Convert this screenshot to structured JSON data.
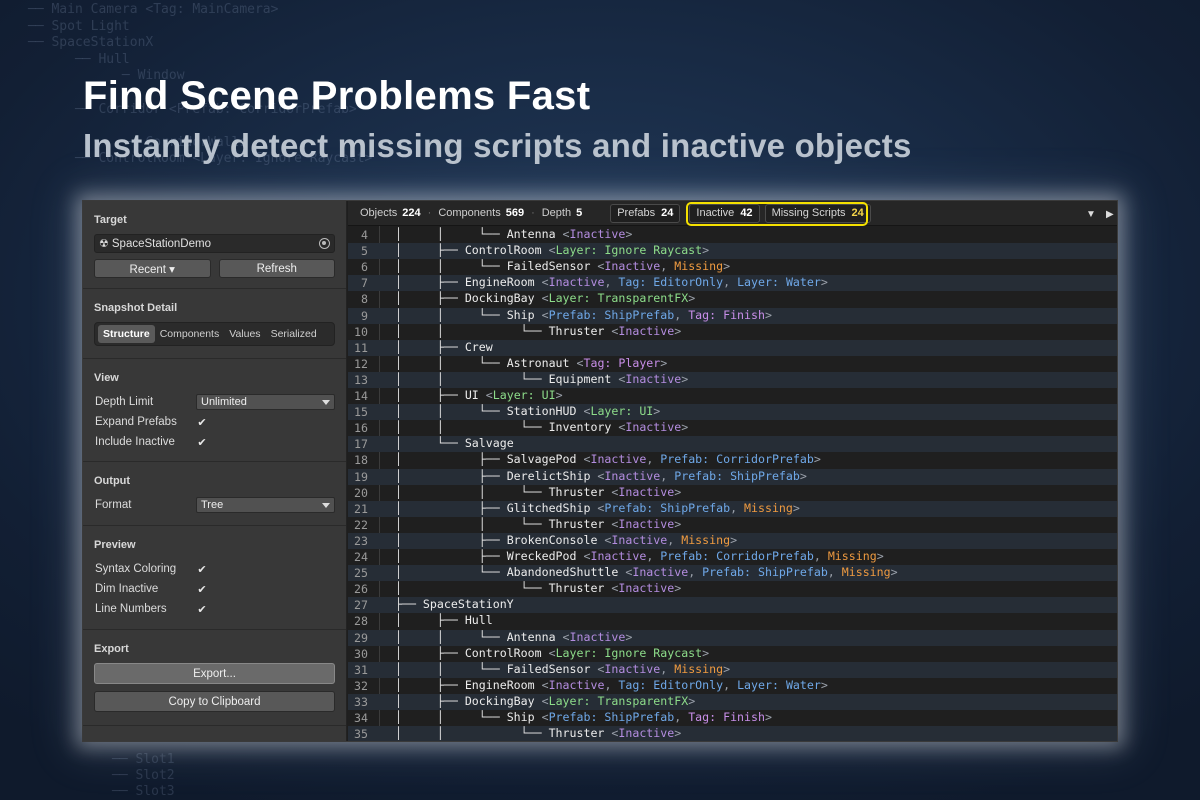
{
  "headline": "Find Scene Problems Fast",
  "subheadline": "Instantly detect missing scripts and inactive objects",
  "background_tree": [
    "── Main Camera <Tag: MainCamera>",
    "── Spot Light",
    "── SpaceStationX",
    "      ── Hull",
    "            ─ Window",
    "",
    "      ── Corridor <Prefab: CorridorPrefab>",
    "",
    "            ── CorridorWalls",
    "      ── ControlRoom <Layer: Ignore Raycast>"
  ],
  "background_tree_bottom": [
    "── Slot1",
    "── Slot2",
    "── Slot3"
  ],
  "sidebar": {
    "target": {
      "title": "Target",
      "value": "SpaceStationDemo",
      "icon": "radiation-icon",
      "recent_label": "Recent ▾",
      "refresh_label": "Refresh"
    },
    "snapshot": {
      "title": "Snapshot Detail",
      "tabs": [
        "Structure",
        "Components",
        "Values",
        "Serialized"
      ],
      "active_tab": "Structure"
    },
    "view": {
      "title": "View",
      "depth_limit_label": "Depth Limit",
      "depth_limit_value": "Unlimited",
      "expand_prefabs_label": "Expand Prefabs",
      "expand_prefabs": true,
      "include_inactive_label": "Include Inactive",
      "include_inactive": true
    },
    "output": {
      "title": "Output",
      "format_label": "Format",
      "format_value": "Tree"
    },
    "preview": {
      "title": "Preview",
      "syntax_coloring_label": "Syntax Coloring",
      "syntax_coloring": true,
      "dim_inactive_label": "Dim Inactive",
      "dim_inactive": true,
      "line_numbers_label": "Line Numbers",
      "line_numbers": true
    },
    "export": {
      "title": "Export",
      "export_label": "Export...",
      "copy_label": "Copy to Clipboard"
    }
  },
  "stats": {
    "objects_label": "Objects",
    "objects": "224",
    "components_label": "Components",
    "components": "569",
    "depth_label": "Depth",
    "depth": "5",
    "prefabs_label": "Prefabs",
    "prefabs": "24",
    "inactive_label": "Inactive",
    "inactive": "42",
    "missing_label": "Missing Scripts",
    "missing": "24"
  },
  "colors": {
    "highlight": "#f4e000",
    "inactive": "#b48de0",
    "layer": "#8ddc8a",
    "tag": "#c88ee8",
    "prefab": "#6fa8e8",
    "missing": "#ee9a40"
  },
  "lines": [
    {
      "n": "4",
      "prefix": "│     │     └── ",
      "name": "Antenna",
      "attrs": [
        {
          "t": "Inactive",
          "k": "inactive"
        }
      ]
    },
    {
      "n": "5",
      "prefix": "│     ├── ",
      "name": "ControlRoom",
      "attrs": [
        {
          "t": "Layer: Ignore Raycast",
          "k": "layer"
        }
      ]
    },
    {
      "n": "6",
      "prefix": "│     │     └── ",
      "name": "FailedSensor",
      "attrs": [
        {
          "t": "Inactive",
          "k": "inactive"
        },
        {
          "t": "Missing",
          "k": "missing"
        }
      ]
    },
    {
      "n": "7",
      "prefix": "│     ├── ",
      "name": "EngineRoom",
      "attrs": [
        {
          "t": "Inactive",
          "k": "inactive"
        },
        {
          "t": "Tag: EditorOnly",
          "k": "prefab"
        },
        {
          "t": "Layer: Water",
          "k": "prefab"
        }
      ]
    },
    {
      "n": "8",
      "prefix": "│     ├── ",
      "name": "DockingBay",
      "attrs": [
        {
          "t": "Layer: TransparentFX",
          "k": "layer"
        }
      ]
    },
    {
      "n": "9",
      "prefix": "│     │     └── ",
      "name": "Ship",
      "attrs": [
        {
          "t": "Prefab: ShipPrefab",
          "k": "prefab"
        },
        {
          "t": "Tag: Finish",
          "k": "tag"
        }
      ]
    },
    {
      "n": "10",
      "prefix": "│     │           └── ",
      "name": "Thruster",
      "attrs": [
        {
          "t": "Inactive",
          "k": "inactive"
        }
      ]
    },
    {
      "n": "11",
      "prefix": "│     ├── ",
      "name": "Crew",
      "attrs": []
    },
    {
      "n": "12",
      "prefix": "│     │     └── ",
      "name": "Astronaut",
      "attrs": [
        {
          "t": "Tag: Player",
          "k": "tag"
        }
      ]
    },
    {
      "n": "13",
      "prefix": "│     │           └── ",
      "name": "Equipment",
      "attrs": [
        {
          "t": "Inactive",
          "k": "inactive"
        }
      ]
    },
    {
      "n": "14",
      "prefix": "│     ├── ",
      "name": "UI",
      "attrs": [
        {
          "t": "Layer: UI",
          "k": "layer"
        }
      ]
    },
    {
      "n": "15",
      "prefix": "│     │     └── ",
      "name": "StationHUD",
      "attrs": [
        {
          "t": "Layer: UI",
          "k": "layer"
        }
      ]
    },
    {
      "n": "16",
      "prefix": "│     │           └── ",
      "name": "Inventory",
      "attrs": [
        {
          "t": "Inactive",
          "k": "inactive"
        }
      ]
    },
    {
      "n": "17",
      "prefix": "│     └── ",
      "name": "Salvage",
      "attrs": []
    },
    {
      "n": "18",
      "prefix": "│           ├── ",
      "name": "SalvagePod",
      "attrs": [
        {
          "t": "Inactive",
          "k": "inactive"
        },
        {
          "t": "Prefab: CorridorPrefab",
          "k": "prefab"
        }
      ]
    },
    {
      "n": "19",
      "prefix": "│           ├── ",
      "name": "DerelictShip",
      "attrs": [
        {
          "t": "Inactive",
          "k": "inactive"
        },
        {
          "t": "Prefab: ShipPrefab",
          "k": "prefab"
        }
      ]
    },
    {
      "n": "20",
      "prefix": "│           │     └── ",
      "name": "Thruster",
      "attrs": [
        {
          "t": "Inactive",
          "k": "inactive"
        }
      ]
    },
    {
      "n": "21",
      "prefix": "│           ├── ",
      "name": "GlitchedShip",
      "attrs": [
        {
          "t": "Prefab: ShipPrefab",
          "k": "prefab"
        },
        {
          "t": "Missing",
          "k": "missing"
        }
      ]
    },
    {
      "n": "22",
      "prefix": "│           │     └── ",
      "name": "Thruster",
      "attrs": [
        {
          "t": "Inactive",
          "k": "inactive"
        }
      ]
    },
    {
      "n": "23",
      "prefix": "│           ├── ",
      "name": "BrokenConsole",
      "attrs": [
        {
          "t": "Inactive",
          "k": "inactive"
        },
        {
          "t": "Missing",
          "k": "missing"
        }
      ]
    },
    {
      "n": "24",
      "prefix": "│           ├── ",
      "name": "WreckedPod",
      "attrs": [
        {
          "t": "Inactive",
          "k": "inactive"
        },
        {
          "t": "Prefab: CorridorPrefab",
          "k": "prefab"
        },
        {
          "t": "Missing",
          "k": "missing"
        }
      ]
    },
    {
      "n": "25",
      "prefix": "│           └── ",
      "name": "AbandonedShuttle",
      "attrs": [
        {
          "t": "Inactive",
          "k": "inactive"
        },
        {
          "t": "Prefab: ShipPrefab",
          "k": "prefab"
        },
        {
          "t": "Missing",
          "k": "missing"
        }
      ]
    },
    {
      "n": "26",
      "prefix": "│                 └── ",
      "name": "Thruster",
      "attrs": [
        {
          "t": "Inactive",
          "k": "inactive"
        }
      ]
    },
    {
      "n": "27",
      "prefix": "├── ",
      "name": "SpaceStationY",
      "attrs": []
    },
    {
      "n": "28",
      "prefix": "│     ├── ",
      "name": "Hull",
      "attrs": []
    },
    {
      "n": "29",
      "prefix": "│     │     └── ",
      "name": "Antenna",
      "attrs": [
        {
          "t": "Inactive",
          "k": "inactive"
        }
      ]
    },
    {
      "n": "30",
      "prefix": "│     ├── ",
      "name": "ControlRoom",
      "attrs": [
        {
          "t": "Layer: Ignore Raycast",
          "k": "layer"
        }
      ]
    },
    {
      "n": "31",
      "prefix": "│     │     └── ",
      "name": "FailedSensor",
      "attrs": [
        {
          "t": "Inactive",
          "k": "inactive"
        },
        {
          "t": "Missing",
          "k": "missing"
        }
      ]
    },
    {
      "n": "32",
      "prefix": "│     ├── ",
      "name": "EngineRoom",
      "attrs": [
        {
          "t": "Inactive",
          "k": "inactive"
        },
        {
          "t": "Tag: EditorOnly",
          "k": "prefab"
        },
        {
          "t": "Layer: Water",
          "k": "prefab"
        }
      ]
    },
    {
      "n": "33",
      "prefix": "│     ├── ",
      "name": "DockingBay",
      "attrs": [
        {
          "t": "Layer: TransparentFX",
          "k": "layer"
        }
      ]
    },
    {
      "n": "34",
      "prefix": "│     │     └── ",
      "name": "Ship",
      "attrs": [
        {
          "t": "Prefab: ShipPrefab",
          "k": "prefab"
        },
        {
          "t": "Tag: Finish",
          "k": "tag"
        }
      ]
    },
    {
      "n": "35",
      "prefix": "│     │           └── ",
      "name": "Thruster",
      "attrs": [
        {
          "t": "Inactive",
          "k": "inactive"
        }
      ]
    }
  ]
}
